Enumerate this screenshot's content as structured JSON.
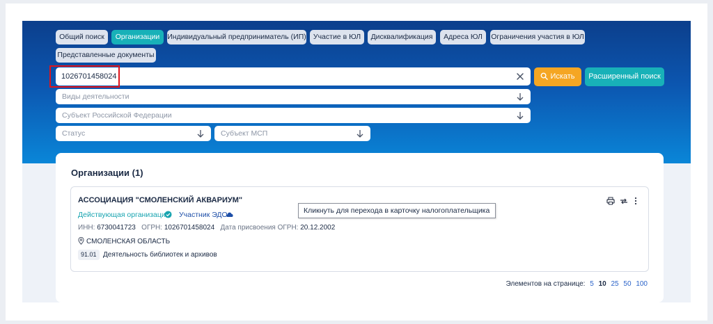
{
  "tabs": [
    {
      "label": "Общий поиск",
      "active": false
    },
    {
      "label": "Организации",
      "active": true
    },
    {
      "label": "Индивидуальный предприниматель (ИП)",
      "active": false
    },
    {
      "label": "Участие в ЮЛ",
      "active": false
    },
    {
      "label": "Дисквалификация",
      "active": false
    },
    {
      "label": "Адреса ЮЛ",
      "active": false
    },
    {
      "label": "Ограничения участия в ЮЛ",
      "active": false
    },
    {
      "label": "Представленные документы",
      "active": false
    }
  ],
  "search": {
    "value": "1026701458024",
    "clear_icon": "close-icon",
    "search_button": "Искать",
    "search_icon": "search-icon",
    "advanced_button": "Расширенный поиск"
  },
  "filters": {
    "activity": "Виды деятельности",
    "region": "Субъект Российской Федерации",
    "status": "Статус",
    "msp": "Субъект МСП"
  },
  "results": {
    "title": "Организации (1)",
    "items": [
      {
        "name": "АССОЦИАЦИЯ \"СМОЛЕНСКИЙ АКВАРИУМ\"",
        "status": "Действующая организация",
        "edo": "Участник ЭДО",
        "inn_label": "ИНН:",
        "inn": "6730041723",
        "ogrn_label": "ОГРН:",
        "ogrn": "1026701458024",
        "ogrn_date_label": "Дата присвоения ОГРН:",
        "ogrn_date": "20.12.2002",
        "region": "СМОЛЕНСКАЯ ОБЛАСТЬ",
        "okved_code": "91.01",
        "okved_name": "Деятельность библиотек и архивов"
      }
    ]
  },
  "tooltip": "Кликнуть для перехода в карточку налогоплательщика",
  "pagination": {
    "label": "Элементов на странице:",
    "options": [
      "5",
      "10",
      "25",
      "50",
      "100"
    ],
    "selected": "10"
  },
  "colors": {
    "accent_teal": "#18b1b8",
    "search_orange": "#f5a623",
    "header_blue": "#0c3f8c",
    "highlight_red": "#e0141a"
  }
}
